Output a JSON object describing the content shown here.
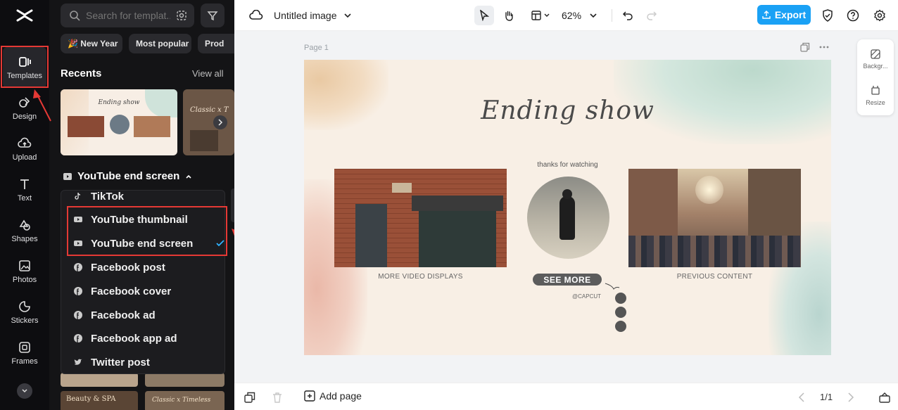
{
  "rail": {
    "items": [
      {
        "label": "Templates",
        "icon": "templates-icon"
      },
      {
        "label": "Design",
        "icon": "design-icon"
      },
      {
        "label": "Upload",
        "icon": "upload-icon"
      },
      {
        "label": "Text",
        "icon": "text-icon"
      },
      {
        "label": "Shapes",
        "icon": "shapes-icon"
      },
      {
        "label": "Photos",
        "icon": "photos-icon"
      },
      {
        "label": "Stickers",
        "icon": "stickers-icon"
      },
      {
        "label": "Frames",
        "icon": "frames-icon"
      }
    ]
  },
  "panel": {
    "search_placeholder": "Search for templat...",
    "chips": [
      "🎉 New Year",
      "Most popular",
      "Prod"
    ],
    "recents_title": "Recents",
    "view_all": "View all",
    "recent_thumbs": [
      {
        "title": "Ending show"
      },
      {
        "title": "Classic x T"
      }
    ],
    "dropdown_label": "YouTube end screen",
    "menu_items": [
      {
        "label": "TikTok",
        "icon": "tiktok-icon"
      },
      {
        "label": "YouTube thumbnail",
        "icon": "youtube-icon"
      },
      {
        "label": "YouTube end screen",
        "icon": "youtube-icon",
        "selected": true
      },
      {
        "label": "Facebook post",
        "icon": "facebook-icon"
      },
      {
        "label": "Facebook cover",
        "icon": "facebook-icon"
      },
      {
        "label": "Facebook ad",
        "icon": "facebook-icon"
      },
      {
        "label": "Facebook app ad",
        "icon": "facebook-icon"
      },
      {
        "label": "Twitter post",
        "icon": "twitter-icon"
      }
    ],
    "bottom_thumbs": [
      {
        "title": "Beauty & SPA"
      },
      {
        "title": "Classic x Timeless"
      }
    ]
  },
  "topbar": {
    "doc_title": "Untitled image",
    "zoom": "62%",
    "export_label": "Export"
  },
  "canvas": {
    "page_label": "Page 1",
    "title": "Ending show",
    "thanks": "thanks for watching",
    "left_caption": "MORE VIDEO DISPLAYS",
    "right_caption": "PREVIOUS CONTENT",
    "see_more": "SEE MORE",
    "handle": "@CAPCUT"
  },
  "rightpanel": {
    "background_label": "Backgr...",
    "resize_label": "Resize"
  },
  "bottombar": {
    "add_page": "Add page",
    "page_counter": "1/1"
  },
  "colors": {
    "accent": "#1aa1f5",
    "highlight": "#e53935",
    "rail_bg": "#0d0d10",
    "panel_bg": "#141416"
  }
}
